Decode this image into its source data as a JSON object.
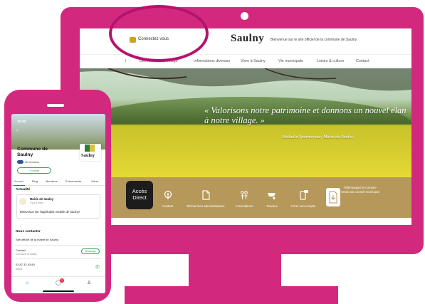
{
  "site": {
    "connect_label": "Connectez vous",
    "brand": "Saulny",
    "tagline": "Bienvenue sur le site officiel de la commune de Saulny",
    "nav": [
      "Découvrir notre village",
      "Informations diverses",
      "Vivre à Saulny",
      "Vie municipale",
      "Loisirs & culture",
      "Contact"
    ],
    "nav_first_partial": "l",
    "quote": "« Valorisons notre patrimoine et donnons un nouvel élan à notre village. »",
    "quote_author": "Nathalie Spormeyeur, Maire de Saulny",
    "acces_direct": "Accès Direct",
    "access_items": [
      {
        "label": "Contact",
        "icon": "location-pin-icon"
      },
      {
        "label": "Démarches administratives",
        "icon": "document-icon"
      },
      {
        "label": "Associations",
        "icon": "people-icon"
      },
      {
        "label": "Travaux",
        "icon": "wheelbarrow-icon"
      },
      {
        "label": "Créer son compte",
        "icon": "phone-chat-icon"
      }
    ],
    "download_label": "Téléchargez le compte-rendu du conseil municipal"
  },
  "phone": {
    "time": "10:50",
    "commune_title": "Commune de Saulny",
    "badge_name": "Saulny",
    "members": "26 membres",
    "follow_label": "+ Inviter",
    "tabs": [
      "Accueil",
      "Blog",
      "Membres",
      "Évènements",
      "Gérer"
    ],
    "section_actualite": "Actualité",
    "post_author": "Mairie de Saulny",
    "post_time": "Il y a 8 mois",
    "post_text": "Bienvenue sur l'application mobile de Saulny!",
    "section_contact": "Nous contacter",
    "site_label": "Site officiel de la mairie de Saulny",
    "contact_label": "Contact",
    "contact_sub": "Commune de Saulny",
    "message_button": "Message",
    "phone_number": "03 87 32 43 80",
    "phone_sub": "Mobile",
    "notif_count": "2"
  },
  "colors": {
    "frame": "#d2297f",
    "access_bar": "#b5985a",
    "accent_green": "#2fa35a",
    "accent_blue": "#1e6ad6"
  }
}
